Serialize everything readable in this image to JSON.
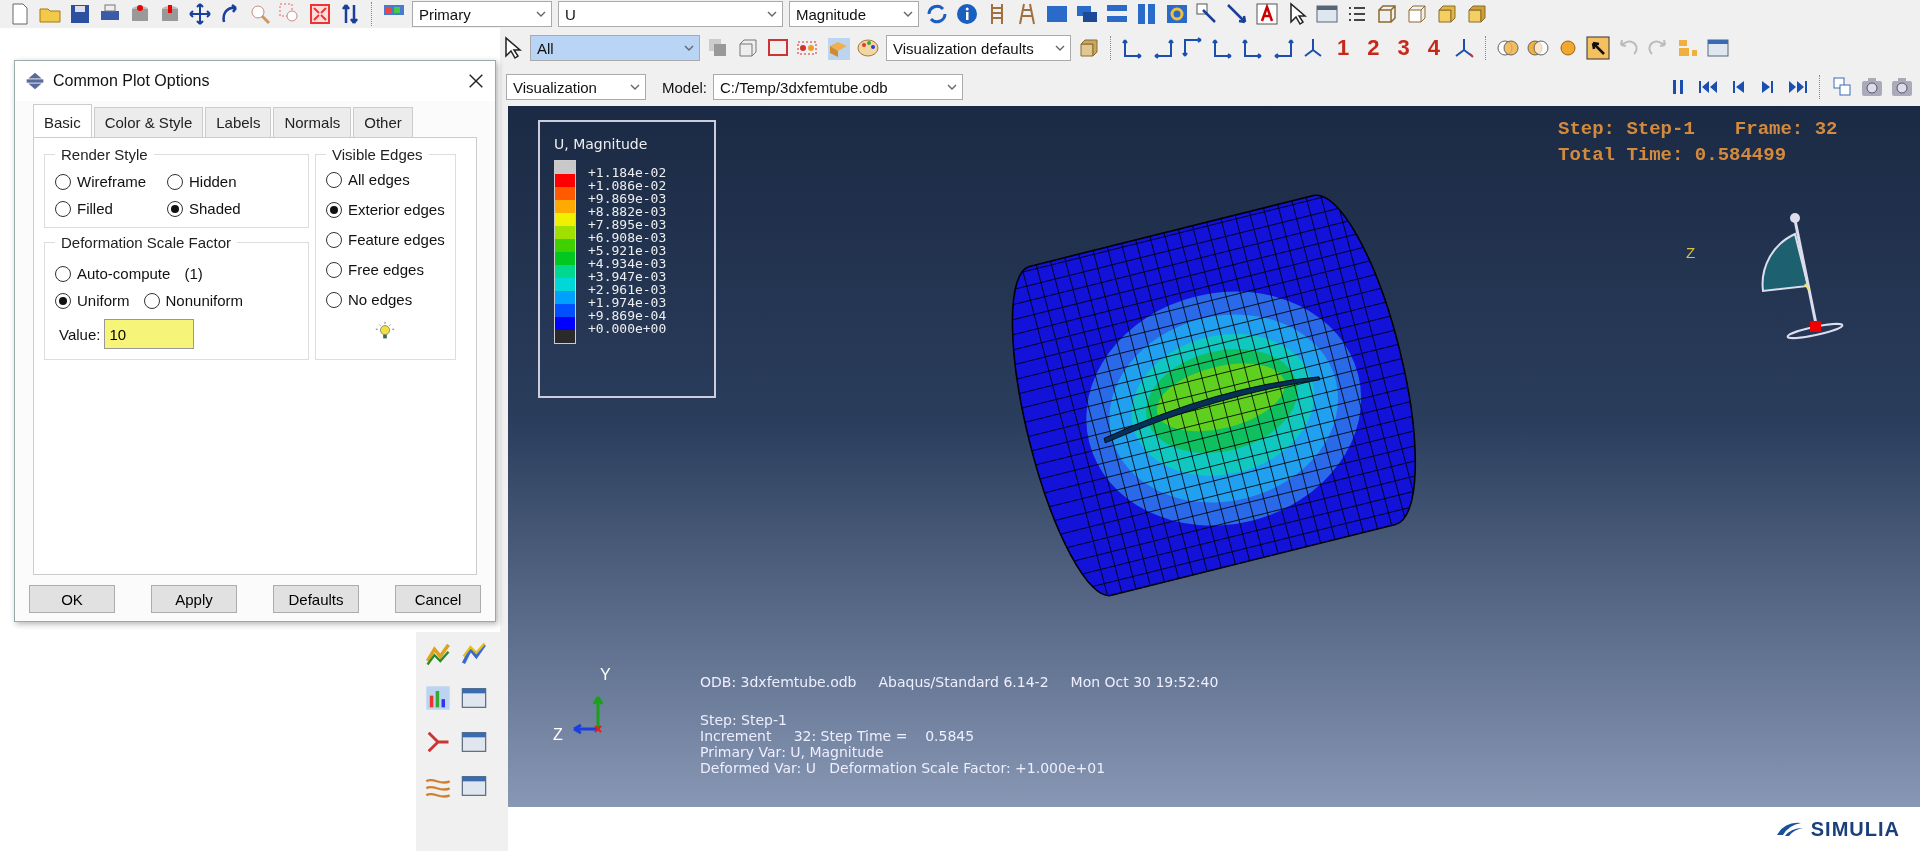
{
  "toolbar_top": {
    "selects": [
      {
        "value": "Primary"
      },
      {
        "value": "U"
      },
      {
        "value": "Magnitude"
      }
    ]
  },
  "toolbar_second": {
    "selection_filter": "All",
    "style_select": "Visualization defaults",
    "view_numbers": [
      "1",
      "2",
      "3",
      "4"
    ]
  },
  "context_bar": {
    "module": "Visualization",
    "model_label": "Model:",
    "model": "C:/Temp/3dxfemtube.odb"
  },
  "dialog": {
    "title": "Common Plot Options",
    "tabs": [
      {
        "label": "Basic",
        "selected": true
      },
      {
        "label": "Color & Style",
        "selected": false
      },
      {
        "label": "Labels",
        "selected": false
      },
      {
        "label": "Normals",
        "selected": false
      },
      {
        "label": "Other",
        "selected": false
      }
    ],
    "render_style": {
      "title": "Render Style",
      "options": [
        {
          "label": "Wireframe",
          "selected": false
        },
        {
          "label": "Hidden",
          "selected": false
        },
        {
          "label": "Filled",
          "selected": false
        },
        {
          "label": "Shaded",
          "selected": true
        }
      ]
    },
    "deformation": {
      "title": "Deformation Scale Factor",
      "options": [
        {
          "label": "Auto-compute",
          "note": "(1)",
          "selected": false
        },
        {
          "label": "Uniform",
          "selected": true
        },
        {
          "label": "Nonuniform",
          "selected": false
        }
      ],
      "value_label": "Value:",
      "value": "10"
    },
    "visible_edges": {
      "title": "Visible Edges",
      "options": [
        {
          "label": "All edges",
          "selected": false
        },
        {
          "label": "Exterior edges",
          "selected": true
        },
        {
          "label": "Feature edges",
          "selected": false
        },
        {
          "label": "Free edges",
          "selected": false
        },
        {
          "label": "No edges",
          "selected": false
        }
      ]
    },
    "buttons": [
      "OK",
      "Apply",
      "Defaults",
      "Cancel"
    ]
  },
  "viewport": {
    "legend": {
      "title": "U, Magnitude",
      "labels": [
        "+1.184e-02",
        "+1.086e-02",
        "+9.869e-03",
        "+8.882e-03",
        "+7.895e-03",
        "+6.908e-03",
        "+5.921e-03",
        "+4.934e-03",
        "+3.947e-03",
        "+2.961e-03",
        "+1.974e-03",
        "+9.869e-04",
        "+0.000e+00"
      ],
      "bands": [
        {
          "color": "#c8c8c8"
        },
        {
          "color": "#ff0000"
        },
        {
          "color": "#ff5a00"
        },
        {
          "color": "#ffaa00"
        },
        {
          "color": "#f0f000"
        },
        {
          "color": "#a0e000"
        },
        {
          "color": "#40d000"
        },
        {
          "color": "#00c820"
        },
        {
          "color": "#00d890"
        },
        {
          "color": "#00d8d8"
        },
        {
          "color": "#00a0ff"
        },
        {
          "color": "#0050ff"
        },
        {
          "color": "#0000ff"
        },
        {
          "color": "#2a2a2a"
        }
      ]
    },
    "state": {
      "step": "Step: Step-1",
      "frame": "Frame: 32",
      "total_time": "Total Time: 0.584499"
    },
    "top_triad": {
      "axis_label": "Z"
    },
    "bottom_triad": {
      "y_label": "Y",
      "z_label": "Z"
    },
    "info": {
      "odb": "ODB: 3dxfemtube.odb",
      "solver": "Abaqus/Standard 6.14-2",
      "date": "Mon Oct 30 19:52:40",
      "lines": [
        "Step: Step-1",
        "Increment     32: Step Time =    0.5845",
        "Primary Var: U, Magnitude",
        "Deformed Var: U   Deformation Scale Factor: +1.000e+01"
      ]
    }
  },
  "brand": "SIMULIA"
}
